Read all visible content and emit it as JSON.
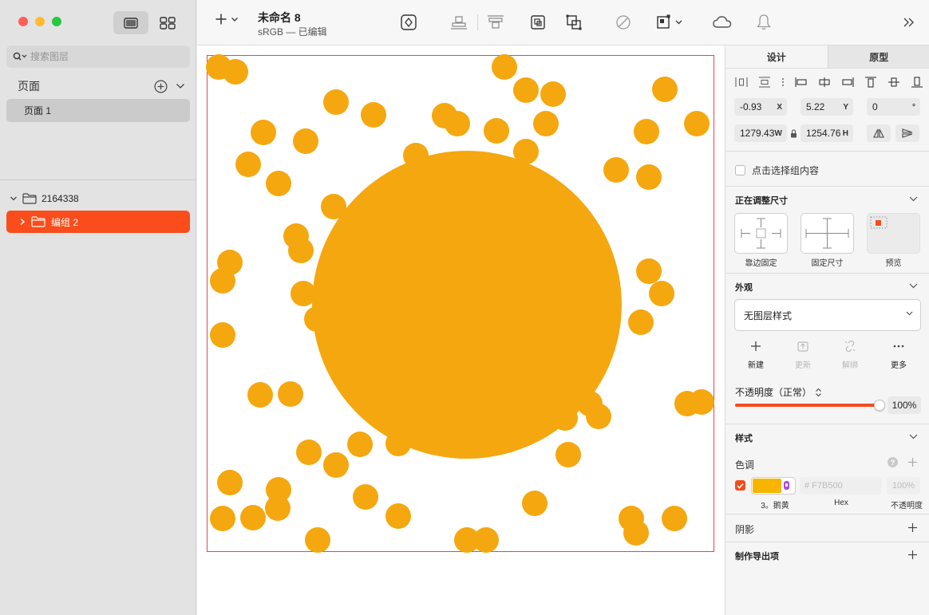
{
  "window": {
    "traffic_lights": {
      "close": "#fe5f57",
      "minimize": "#febc2e",
      "zoom": "#28c840"
    }
  },
  "sidebar": {
    "search": {
      "placeholder": "搜索图层",
      "value": ""
    },
    "pages_header": "页面",
    "pages": [
      {
        "label": "页面 1",
        "selected": true
      }
    ],
    "layers": [
      {
        "label": "2164338",
        "expanded": true,
        "type": "folder"
      },
      {
        "label": "编组 2",
        "expanded": false,
        "type": "folder",
        "selected": true
      }
    ]
  },
  "toolbar": {
    "title": "未命名 8",
    "subtitle": "sRGB — 已编辑",
    "icons": [
      "add-icon",
      "symbol-icon",
      "align-bottom-icon",
      "align-top-icon",
      "group-icon",
      "ungroup-icon",
      "mask-icon",
      "resize-icon",
      "cloud-icon",
      "bell-icon",
      "expand-icon"
    ]
  },
  "canvas": {
    "fill_color": "#f5a70f",
    "artboard_border": "#e8434f",
    "artboard_background": "#ffffff"
  },
  "inspector": {
    "tabs": [
      {
        "label": "设计",
        "active": true
      },
      {
        "label": "原型",
        "active": false
      }
    ],
    "position": {
      "x": "-0.93",
      "x_unit": "X",
      "y": "5.22",
      "y_unit": "Y",
      "rotation": "0",
      "rotation_unit": "°"
    },
    "size": {
      "w": "1279.43",
      "w_unit": "W",
      "h": "1254.76",
      "h_unit": "H"
    },
    "select_group_contents": "点击选择组内容",
    "resizing": {
      "title": "正在调整尺寸",
      "options": [
        {
          "label": "靠边固定"
        },
        {
          "label": "固定尺寸"
        },
        {
          "label": "预览"
        }
      ]
    },
    "appearance": {
      "title": "外观",
      "layer_style": "无图层样式",
      "actions": [
        {
          "label": "新建",
          "enabled": true,
          "icon": "plus-icon"
        },
        {
          "label": "更新",
          "enabled": false,
          "icon": "update-icon"
        },
        {
          "label": "解绑",
          "enabled": false,
          "icon": "unlink-icon"
        },
        {
          "label": "更多",
          "enabled": true,
          "icon": "more-icon"
        }
      ],
      "opacity_label": "不透明度（正常）",
      "opacity_value": "100%",
      "opacity_fraction": 1.0
    },
    "style": {
      "title": "样式",
      "tint": "色调",
      "help": "?",
      "fill": {
        "enabled": true,
        "color": "#f7b500",
        "color_name": "3。鹅黄",
        "hex_placeholder": "# F7B500",
        "opacity_placeholder": "100%",
        "labels": {
          "hex": "Hex",
          "opacity": "不透明度"
        }
      }
    },
    "shadow": {
      "title": "阴影"
    },
    "export": {
      "title": "制作导出项"
    }
  }
}
